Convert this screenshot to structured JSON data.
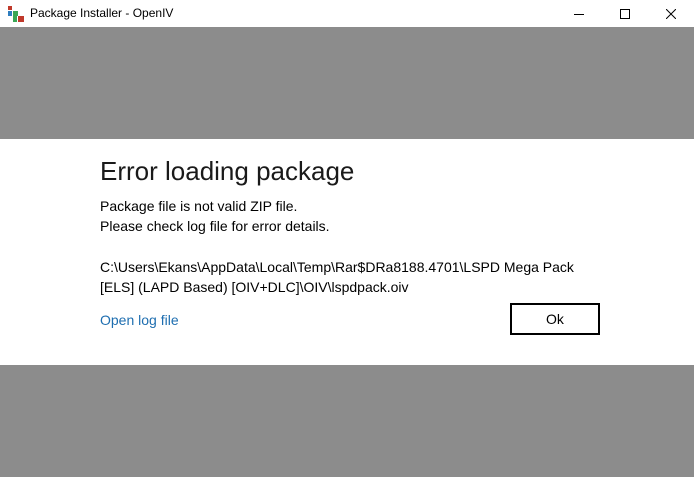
{
  "window": {
    "title": "Package Installer - OpenIV",
    "icon": "openiv-app-icon",
    "controls": [
      "minimize-icon",
      "maximize-icon",
      "close-icon"
    ]
  },
  "dialog": {
    "heading": "Error loading package",
    "message_line1": "Package file is not valid ZIP file.",
    "message_line2": "Please check log file for error details.",
    "path_line1": "C:\\Users\\Ekans\\AppData\\Local\\Temp\\Rar$DRa8188.4701\\LSPD Mega Pack",
    "path_line2": "[ELS] (LAPD Based) [OIV+DLC]\\OIV\\lspdpack.oiv",
    "link_label": "Open log file",
    "ok_label": "Ok"
  },
  "colors": {
    "overlay_gray": "#8c8c8c",
    "link_blue": "#1e6eb0",
    "icon_red": "#c0392b",
    "icon_green": "#3aa655"
  }
}
